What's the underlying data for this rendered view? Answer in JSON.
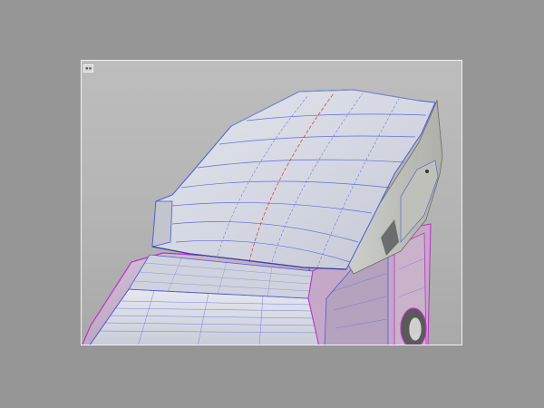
{
  "viewport": {
    "label_icon": "viewport-menu-icon",
    "label_text": "",
    "colors": {
      "frame": "#f2f2f2",
      "background": "#b9b9b9",
      "surface": "#d4d6e2",
      "wire_blue": "#4c5ad8",
      "wire_magenta": "#c030c8",
      "wire_red": "#cc4a4a"
    }
  },
  "model": {
    "parts": [
      "roof-pod",
      "roof-pod-side",
      "windshield",
      "a-pillar",
      "door-panel",
      "rear-wheel"
    ]
  }
}
